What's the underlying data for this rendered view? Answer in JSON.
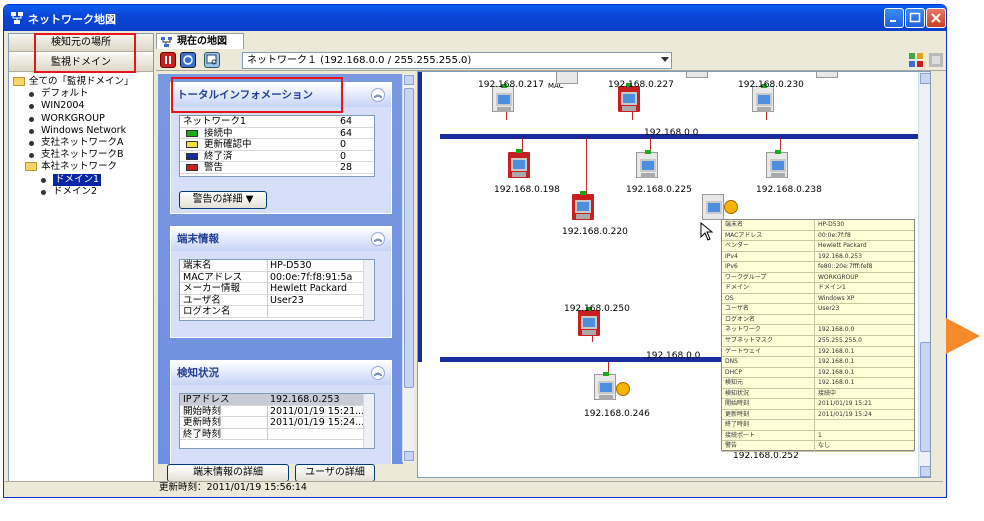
{
  "window": {
    "title": "ネットワーク地図"
  },
  "left": {
    "tab1": "検知元の場所",
    "tab2": "監視ドメイン",
    "tree": [
      {
        "label": "全ての「監視ドメイン」",
        "indent": 0,
        "type": "folder"
      },
      {
        "label": "デフォルト",
        "indent": 1,
        "type": "dot"
      },
      {
        "label": "WIN2004",
        "indent": 1,
        "type": "dot"
      },
      {
        "label": "WORKGROUP",
        "indent": 1,
        "type": "dot"
      },
      {
        "label": "Windows Network",
        "indent": 1,
        "type": "dot"
      },
      {
        "label": "支社ネットワークA",
        "indent": 1,
        "type": "dot"
      },
      {
        "label": "支社ネットワークB",
        "indent": 1,
        "type": "dot"
      },
      {
        "label": "本社ネットワーク",
        "indent": 1,
        "type": "folder"
      },
      {
        "label": "ドメイン1",
        "indent": 2,
        "type": "dot",
        "selected": true
      },
      {
        "label": "ドメイン2",
        "indent": 2,
        "type": "dot"
      }
    ]
  },
  "tab": {
    "label": "現在の地図"
  },
  "toolbar": {
    "network": "ネットワーク１ (192.168.0.0 / 255.255.255.0)"
  },
  "total": {
    "title": "トータルインフォメーション",
    "rows": [
      {
        "label": "ネットワーク1",
        "value": "64",
        "color": ""
      },
      {
        "label": "接続中",
        "value": "64",
        "color": "#1ba81b"
      },
      {
        "label": "更新確認中",
        "value": "0",
        "color": "#f0e040"
      },
      {
        "label": "終了済",
        "value": "0",
        "color": "#1a2b9c"
      },
      {
        "label": "警告",
        "value": "28",
        "color": "#c82020"
      }
    ],
    "detail_btn": "警告の詳細 ▼"
  },
  "terminal": {
    "title": "端末情報",
    "rows": [
      {
        "label": "端末名",
        "value": "HP-D530"
      },
      {
        "label": "MACアドレス",
        "value": "00:0e:7f:f8:91:5a"
      },
      {
        "label": "メーカー情報",
        "value": "Hewlett Packard"
      },
      {
        "label": "ユーザ名",
        "value": "User23"
      },
      {
        "label": "ログオン名",
        "value": ""
      }
    ]
  },
  "detect": {
    "title": "検知状況",
    "rows": [
      {
        "label": "IPアドレス",
        "value": "192.168.0.253"
      },
      {
        "label": "開始時刻",
        "value": "2011/01/19 15:21..."
      },
      {
        "label": "更新時刻",
        "value": "2011/01/19 15:24..."
      },
      {
        "label": "終了時刻",
        "value": ""
      }
    ]
  },
  "buttons": {
    "terminal_detail": "端末情報の詳細",
    "user_detail": "ユーザの詳細"
  },
  "map": {
    "subnet_top": "192.168.0.0",
    "subnet_bottom": "192.168.0.0",
    "mac_label": "MAC",
    "nodes": [
      {
        "ip": "192.168.0.217"
      },
      {
        "ip": "192.168.0.227"
      },
      {
        "ip": "192.168.0.230"
      },
      {
        "ip": "192.168.0.198"
      },
      {
        "ip": "192.168.0.225"
      },
      {
        "ip": "192.168.0.238"
      },
      {
        "ip": "192.168.0.220"
      },
      {
        "ip": "192.168.0.250"
      },
      {
        "ip": "192.168.0.246"
      },
      {
        "ip": "192.168.0.252"
      }
    ],
    "popup_rows": [
      [
        "端末名",
        "HP-D530"
      ],
      [
        "MACアドレス",
        "00:0e:7f:f8"
      ],
      [
        "ベンダー",
        "Hewlett Packard"
      ],
      [
        "IPv4",
        "192.168.0.253"
      ],
      [
        "IPv6",
        "fe80::20e:7fff:fef8"
      ],
      [
        "ワークグループ",
        "WORKGROUP"
      ],
      [
        "ドメイン",
        "ドメイン1"
      ],
      [
        "OS",
        "Windows XP"
      ],
      [
        "ユーザ名",
        "User23"
      ],
      [
        "ログオン名",
        ""
      ],
      [
        "ネットワーク",
        "192.168.0.0"
      ],
      [
        "サブネットマスク",
        "255.255.255.0"
      ],
      [
        "ゲートウェイ",
        "192.168.0.1"
      ],
      [
        "DNS",
        "192.168.0.1"
      ],
      [
        "DHCP",
        "192.168.0.1"
      ],
      [
        "検知元",
        "192.168.0.1"
      ],
      [
        "検知状況",
        "接続中"
      ],
      [
        "開始時刻",
        "2011/01/19 15:21"
      ],
      [
        "更新時刻",
        "2011/01/19 15:24"
      ],
      [
        "終了時刻",
        ""
      ],
      [
        "接続ポート",
        "1"
      ],
      [
        "警告",
        "なし"
      ]
    ]
  },
  "status": {
    "text": "更新時刻：2011/01/19 15:56:14"
  }
}
